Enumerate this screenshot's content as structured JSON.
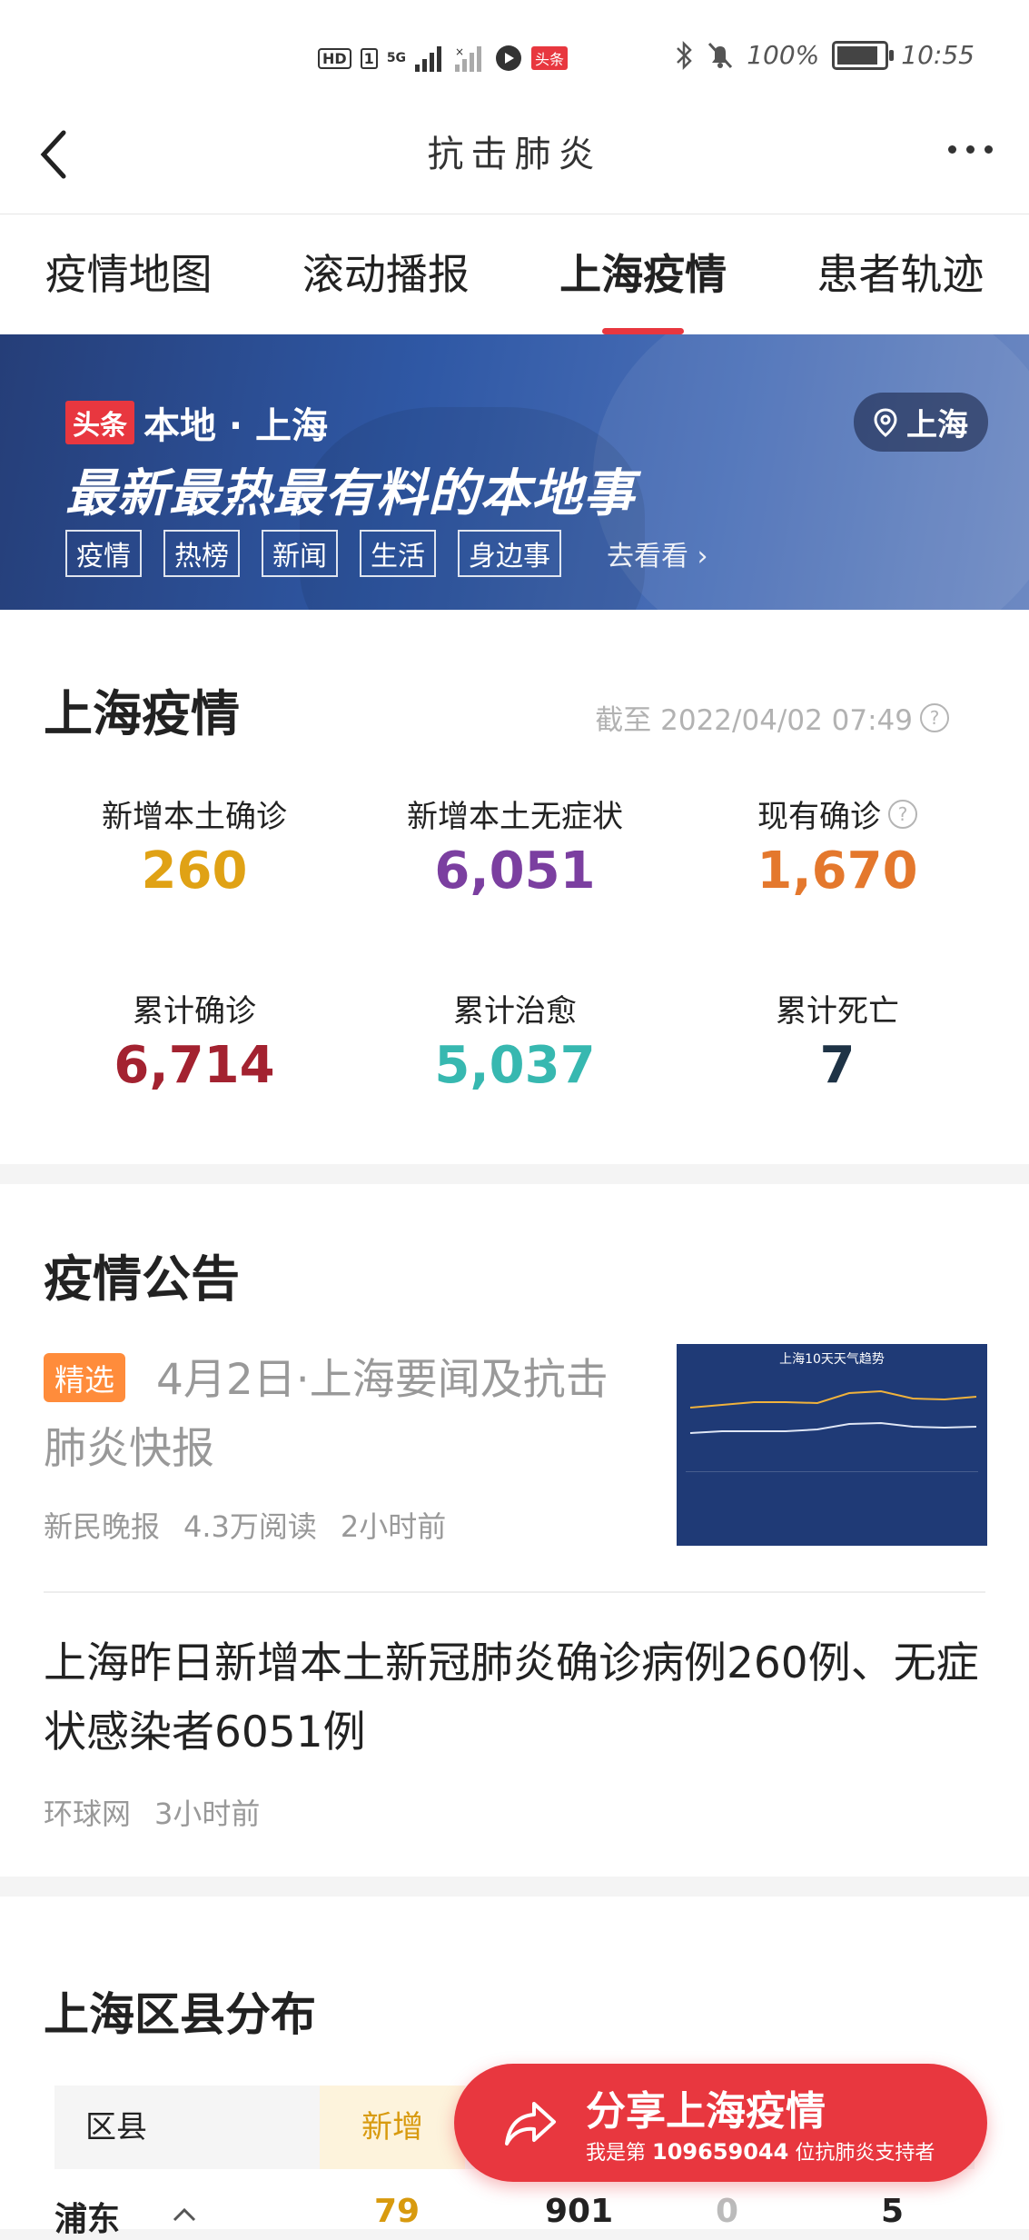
{
  "status_bar": {
    "hd": "HD",
    "sim": "1",
    "net": "5G",
    "badge": "头条",
    "battery_text": "100%",
    "battery_level": 1.0,
    "time": "10:55"
  },
  "nav": {
    "title": "抗击肺炎"
  },
  "tabs": [
    {
      "label": "疫情地图"
    },
    {
      "label": "滚动播报"
    },
    {
      "label": "上海疫情",
      "active": true
    },
    {
      "label": "患者轨迹"
    }
  ],
  "banner": {
    "brand_badge": "头条",
    "brand_text": "本地 · 上海",
    "headline": "最新最热最有料的本地事",
    "tags": [
      "疫情",
      "热榜",
      "新闻",
      "生活",
      "身边事"
    ],
    "more": "去看看 ›",
    "location": "上海"
  },
  "stats": {
    "title": "上海疫情",
    "timestamp": "截至 2022/04/02 07:49",
    "items": [
      {
        "label": "新增本土确诊",
        "value": "260",
        "color": "#e0a215"
      },
      {
        "label": "新增本土无症状",
        "value": "6,051",
        "color": "#7b3fa0"
      },
      {
        "label": "现有确诊",
        "value": "1,670",
        "color": "#e4782d"
      },
      {
        "label": "累计确诊",
        "value": "6,714",
        "color": "#a32230"
      },
      {
        "label": "累计治愈",
        "value": "5,037",
        "color": "#37b8b0"
      },
      {
        "label": "累计死亡",
        "value": "7",
        "color": "#1e3346"
      }
    ]
  },
  "notices": {
    "title": "疫情公告",
    "items": [
      {
        "tag": "精选",
        "title": "4月2日·上海要闻及抗击肺炎快报",
        "source": "新民晚报",
        "reads": "4.3万阅读",
        "time": "2小时前",
        "thumb_title": "上海10天天气趋势"
      },
      {
        "title": "上海昨日新增本土新冠肺炎确诊病例260例、无症状感染者6051例",
        "source": "环球网",
        "time": "3小时前"
      }
    ]
  },
  "district": {
    "title": "上海区县分布",
    "headers": [
      "区县",
      "新增"
    ],
    "row": {
      "name": "浦东",
      "new": "79",
      "v2": "901",
      "v3": "0",
      "v4": "5"
    }
  },
  "share": {
    "title": "分享上海疫情",
    "sub_prefix": "我是第",
    "sub_number": "109659044",
    "sub_suffix": "位抗肺炎支持者"
  }
}
